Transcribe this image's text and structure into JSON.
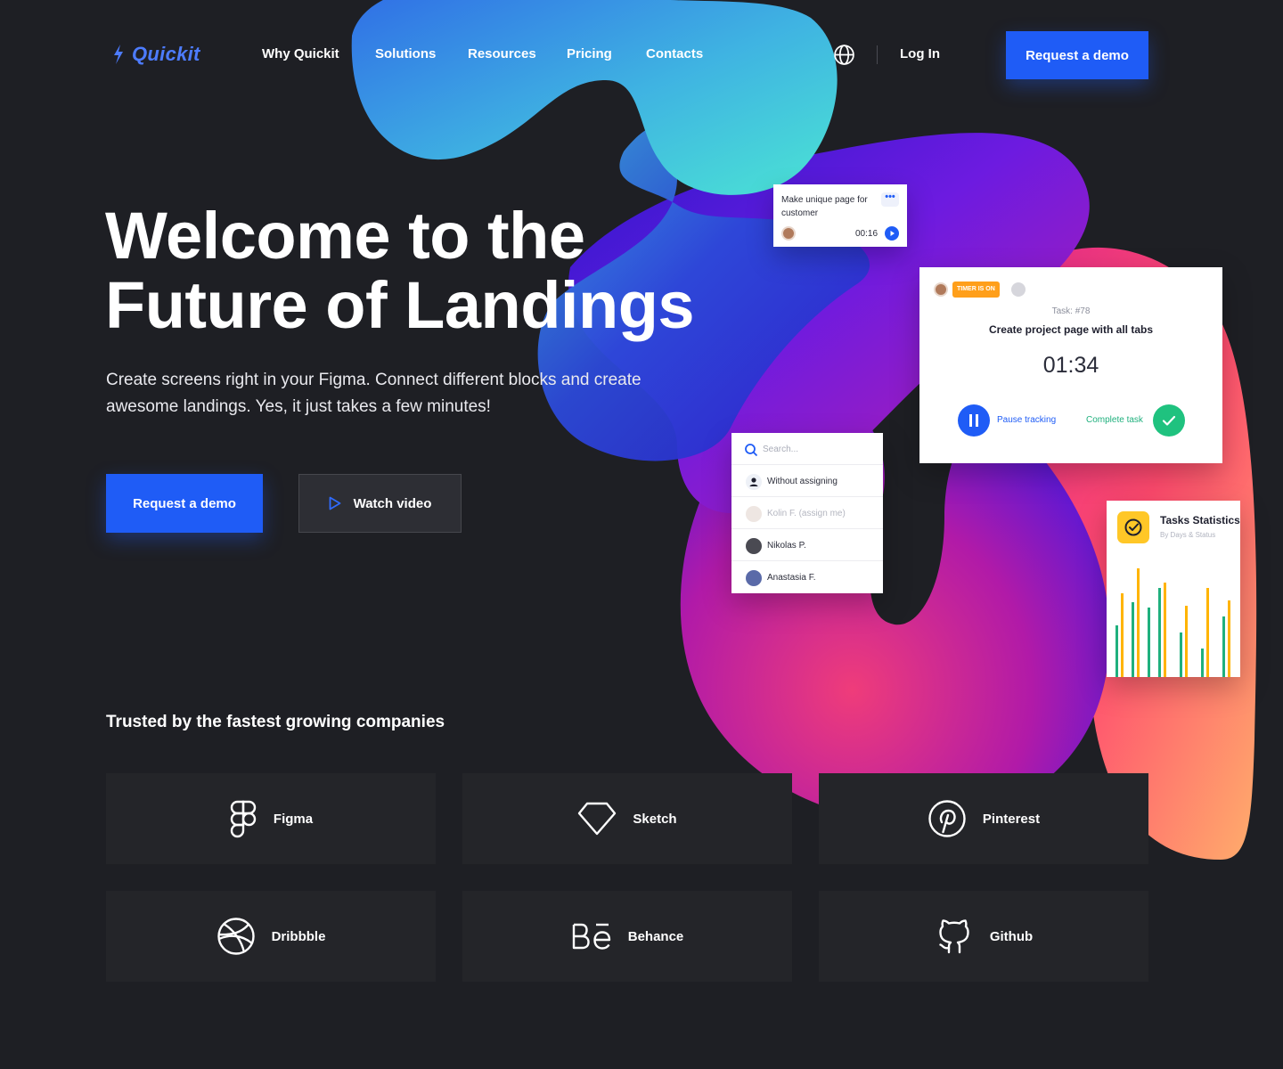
{
  "nav": {
    "logo_text": "Quickit",
    "links": [
      "Why Quickit",
      "Solutions",
      "Resources",
      "Pricing",
      "Contacts"
    ],
    "login_label": "Log In",
    "cta_label": "Request a demo"
  },
  "hero": {
    "title_line1": "Welcome to the",
    "title_line2": "Future of Landings",
    "subtitle_line1": "Create screens right in your Figma. Connect different blocks and create",
    "subtitle_line2": "awesome landings. Yes, it just takes a few minutes!",
    "cta_label": "Request a demo",
    "video_label": "Watch video"
  },
  "task_card": {
    "title": "Make unique page for customer",
    "more": "•••",
    "time": "00:16"
  },
  "timer_card": {
    "badge": "TIMER IS ON",
    "task_number": "Task: #78",
    "task_title": "Create project page with all tabs",
    "clock": "01:34",
    "pause_label": "Pause tracking",
    "complete_label": "Complete task"
  },
  "assign_card": {
    "search_placeholder": "Search...",
    "rows": [
      "Without assigning",
      "Kolin F.  (assign me)",
      "Nikolas P.",
      "Anastasia F."
    ]
  },
  "stats_card": {
    "title": "Tasks Statistics",
    "subtitle": "By Days & Status",
    "colors": {
      "green": "#1fb07d",
      "yellow": "#ffb400"
    }
  },
  "trusted": {
    "title": "Trusted by the fastest growing companies",
    "brands": [
      {
        "name": "Figma",
        "icon": "figma-icon"
      },
      {
        "name": "Sketch",
        "icon": "sketch-icon"
      },
      {
        "name": "Pinterest",
        "icon": "pinterest-icon"
      },
      {
        "name": "Dribbble",
        "icon": "dribbble-icon"
      },
      {
        "name": "Behance",
        "icon": "behance-icon"
      },
      {
        "name": "Github",
        "icon": "github-icon"
      }
    ]
  },
  "colors": {
    "background": "#1e1f24",
    "accent": "#1f5cf6",
    "tile": "#242529"
  }
}
